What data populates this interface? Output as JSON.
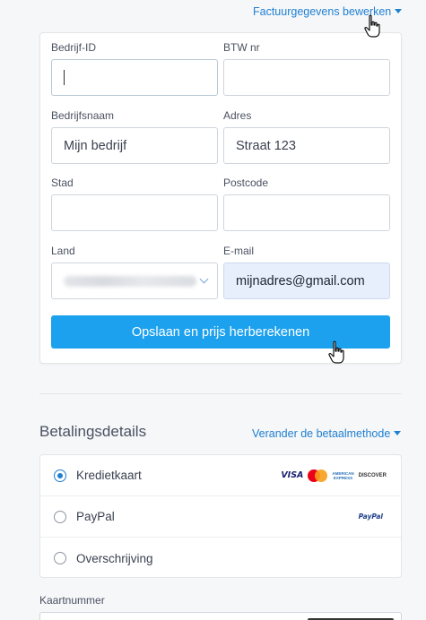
{
  "header": {
    "edit_link": "Factuurgegevens bewerken"
  },
  "billing_form": {
    "company_id": {
      "label": "Bedrijf-ID",
      "value": ""
    },
    "vat": {
      "label": "BTW nr",
      "value": ""
    },
    "company_name": {
      "label": "Bedrijfsnaam",
      "placeholder": "Mijn bedrijf"
    },
    "address": {
      "label": "Adres",
      "placeholder": "Straat 123"
    },
    "city": {
      "label": "Stad",
      "value": ""
    },
    "postcode": {
      "label": "Postcode",
      "value": ""
    },
    "country": {
      "label": "Land"
    },
    "email": {
      "label": "E-mail",
      "value": "mijnadres@gmail.com"
    },
    "save_button": "Opslaan en prijs herberekenen"
  },
  "payment": {
    "title": "Betalingsdetails",
    "change_link": "Verander de betaalmethode",
    "methods": [
      {
        "label": "Kredietkaart",
        "selected": true
      },
      {
        "label": "PayPal",
        "selected": false
      },
      {
        "label": "Overschrijving",
        "selected": false
      }
    ],
    "logos": {
      "visa": "VISA",
      "amex_line1": "AMERICAN",
      "amex_line2": "EXPRESS",
      "discover": "DISCOVER",
      "paypal": "PayPal"
    },
    "card_number_label": "Kaartnummer"
  },
  "colors": {
    "accent": "#1f7fd1",
    "button": "#1ca1ee",
    "email_bg": "#e7effd"
  }
}
